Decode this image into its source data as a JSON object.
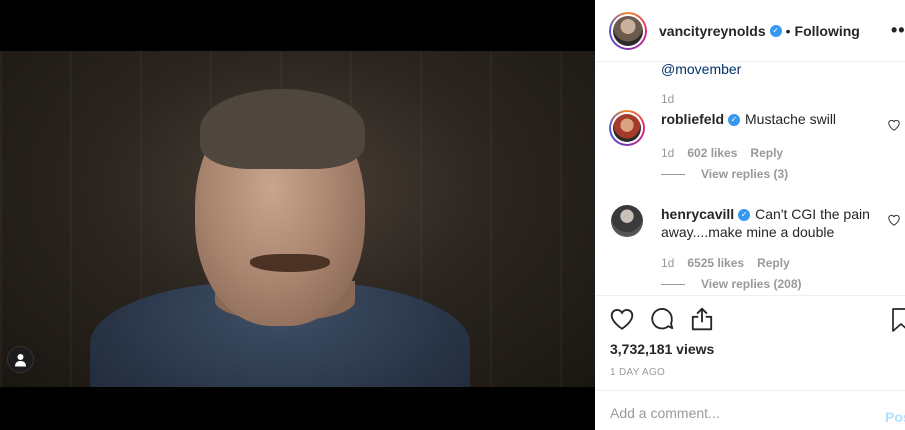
{
  "post": {
    "author": "vancityreynolds",
    "separator": "•",
    "follow_status": "Following",
    "more_label": "•••",
    "verified_mark": "✓"
  },
  "caption_tail": {
    "mention": "@movember",
    "time": "1d"
  },
  "comments": [
    {
      "username": "robliefeld",
      "text": "Mustache swill",
      "time": "1d",
      "likes": "602 likes",
      "reply_label": "Reply",
      "view_replies": "View replies (3)"
    },
    {
      "username": "henrycavill",
      "text": "Can't CGI the pain away....make mine a double",
      "time": "1d",
      "likes": "6525 likes",
      "reply_label": "Reply",
      "view_replies": "View replies (208)"
    }
  ],
  "stats": {
    "views": "3,732,181 views",
    "posted": "1 DAY AGO"
  },
  "compose": {
    "placeholder": "Add a comment...",
    "post_label": "Post"
  },
  "icons": {
    "like": "heart-icon",
    "comment": "comment-icon",
    "share": "share-icon",
    "save": "bookmark-icon",
    "profile": "user-tag-icon"
  },
  "colors": {
    "link": "#003569",
    "verified": "#3897f0",
    "muted": "#999999",
    "post_button": "#b2dffc"
  }
}
